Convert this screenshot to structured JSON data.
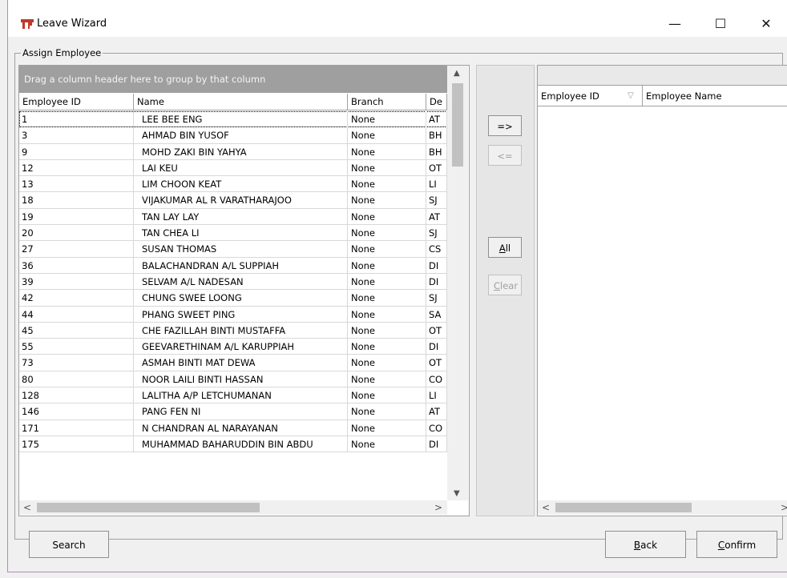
{
  "window": {
    "title": "Leave Wizard",
    "minimize": "—",
    "maximize": "☐",
    "close": "✕"
  },
  "group": {
    "label": "Assign Employee"
  },
  "left_grid": {
    "group_panel": "Drag a column header here to group by that column",
    "columns": [
      "Employee ID",
      "Name",
      "Branch",
      "De"
    ],
    "rows": [
      [
        "1",
        "LEE BEE ENG",
        "None",
        "AT"
      ],
      [
        "3",
        "AHMAD BIN YUSOF",
        "None",
        "BH"
      ],
      [
        "9",
        "MOHD ZAKI BIN YAHYA",
        "None",
        "BH"
      ],
      [
        "12",
        "LAI KEU",
        "None",
        "OT"
      ],
      [
        "13",
        "LIM CHOON KEAT",
        "None",
        "LI"
      ],
      [
        "18",
        "VIJAKUMAR AL R VARATHARAJOO",
        "None",
        "SJ"
      ],
      [
        "19",
        "TAN LAY LAY",
        "None",
        "AT"
      ],
      [
        "20",
        "TAN CHEA LI",
        "None",
        "SJ"
      ],
      [
        "27",
        "SUSAN THOMAS",
        "None",
        "CS"
      ],
      [
        "36",
        "BALACHANDRAN A/L SUPPIAH",
        "None",
        "DI"
      ],
      [
        "39",
        "SELVAM A/L NADESAN",
        "None",
        "DI"
      ],
      [
        "42",
        "CHUNG SWEE LOONG",
        "None",
        "SJ"
      ],
      [
        "44",
        "PHANG SWEET PING",
        "None",
        "SA"
      ],
      [
        "45",
        "CHE FAZILLAH BINTI MUSTAFFA",
        "None",
        "OT"
      ],
      [
        "55",
        "GEEVARETHINAM A/L KARUPPIAH",
        "None",
        "DI"
      ],
      [
        "73",
        "ASMAH BINTI MAT DEWA",
        "None",
        "OT"
      ],
      [
        "80",
        "NOOR LAILI BINTI HASSAN",
        "None",
        "CO"
      ],
      [
        "128",
        "LALITHA A/P LETCHUMANAN",
        "None",
        "LI"
      ],
      [
        "146",
        "PANG FEN NI",
        "None",
        "AT"
      ],
      [
        "171",
        "N CHANDRAN AL NARAYANAN",
        "None",
        "CO"
      ],
      [
        "175",
        "MUHAMMAD BAHARUDDIN BIN ABDU",
        "None",
        "DI"
      ]
    ]
  },
  "mid_buttons": {
    "add": "=>",
    "remove": "<=",
    "all_prefix": "A",
    "all_rest": "ll",
    "clear_prefix": "C",
    "clear_rest": "lear"
  },
  "right_grid": {
    "columns": [
      "Employee ID",
      "Employee Name"
    ],
    "sort_glyph": "▽"
  },
  "bottom_buttons": {
    "search": "Search",
    "back_prefix": "B",
    "back_rest": "ack",
    "confirm_prefix": "C",
    "confirm_rest": "onfirm"
  },
  "scroll_glyphs": {
    "up": "▲",
    "down": "▼",
    "left": "<",
    "right": ">"
  },
  "icons": {
    "app_icon_color": "#c0392b",
    "thumb_color": "#c1c1c1",
    "group_panel_color": "#9f9f9f"
  }
}
